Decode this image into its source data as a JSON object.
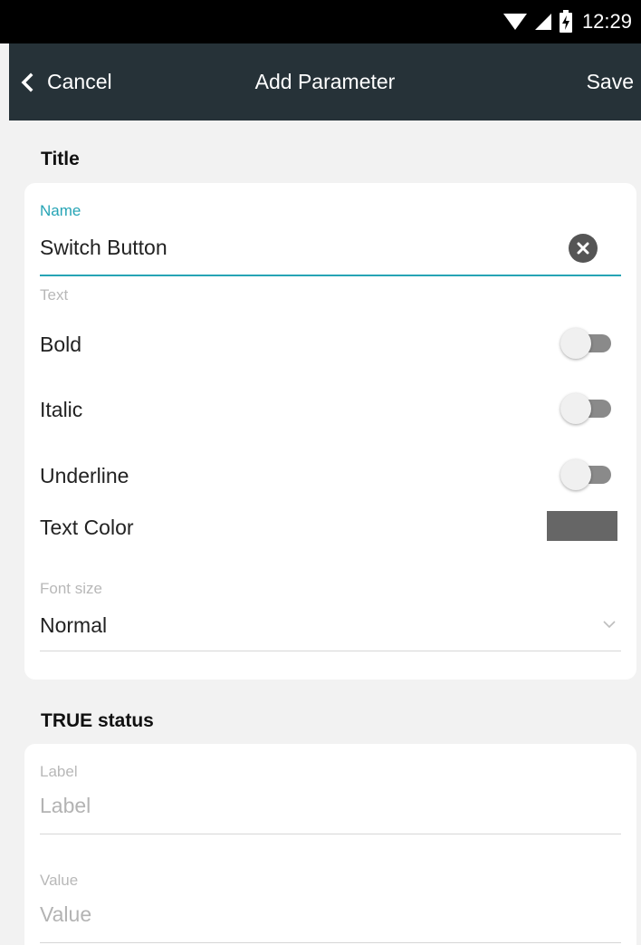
{
  "status_bar": {
    "time": "12:29",
    "icons": [
      "wifi-icon",
      "signal-icon",
      "battery-charging-icon"
    ]
  },
  "toolbar": {
    "back_icon": "chevron-left-icon",
    "cancel_label": "Cancel",
    "title": "Add Parameter",
    "save_label": "Save"
  },
  "title_section": {
    "heading": "Title",
    "name_label": "Name",
    "name_value": "Switch Button",
    "text_label": "Text",
    "bold_label": "Bold",
    "bold_on": false,
    "italic_label": "Italic",
    "italic_on": false,
    "underline_label": "Underline",
    "underline_on": false,
    "text_color_label": "Text Color",
    "text_color": "#666666",
    "font_size_label": "Font size",
    "font_size_value": "Normal"
  },
  "true_status": {
    "heading": "TRUE status",
    "label_label": "Label",
    "label_placeholder": "Label",
    "value_label": "Value",
    "value_placeholder": "Value"
  },
  "colors": {
    "toolbar_bg": "#263238",
    "accent": "#26a4b5",
    "background": "#f2f2f2",
    "card": "#ffffff"
  }
}
